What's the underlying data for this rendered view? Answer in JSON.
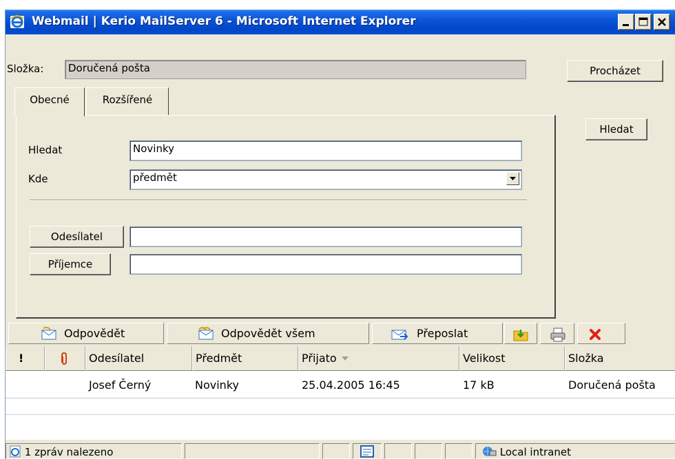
{
  "window": {
    "title": "Webmail | Kerio MailServer 6 - Microsoft Internet Explorer"
  },
  "folder": {
    "label": "Složka:",
    "value": "Doručená pošta",
    "browse_label": "Procházet"
  },
  "tabs": [
    {
      "label": "Obecné",
      "active": true
    },
    {
      "label": "Rozšířené",
      "active": false
    }
  ],
  "search": {
    "search_label": "Hledat",
    "search_value": "Novinky",
    "where_label": "Kde",
    "where_value": "předmět",
    "submit_label": "Hledat",
    "sender_button": "Odesílatel",
    "sender_value": "",
    "recipient_button": "Příjemce",
    "recipient_value": ""
  },
  "toolbar": {
    "reply": "Odpovědět",
    "reply_all": "Odpovědět všem",
    "forward": "Přeposlat"
  },
  "columns": {
    "flag": "!",
    "sender": "Odesílatel",
    "subject": "Předmět",
    "received": "Přijato",
    "size": "Velikost",
    "folder": "Složka"
  },
  "rows": [
    {
      "sender": "Josef  Černý",
      "subject": "Novinky",
      "received": "25.04.2005 16:45",
      "size": "17 kB",
      "folder": "Doručená pošta"
    }
  ],
  "status": {
    "found": "1 zpráv nalezeno",
    "zone": "Local intranet"
  },
  "colors": {
    "titlebar": "#0a53d4",
    "face": "#ece9d8",
    "delete": "#e02010"
  }
}
